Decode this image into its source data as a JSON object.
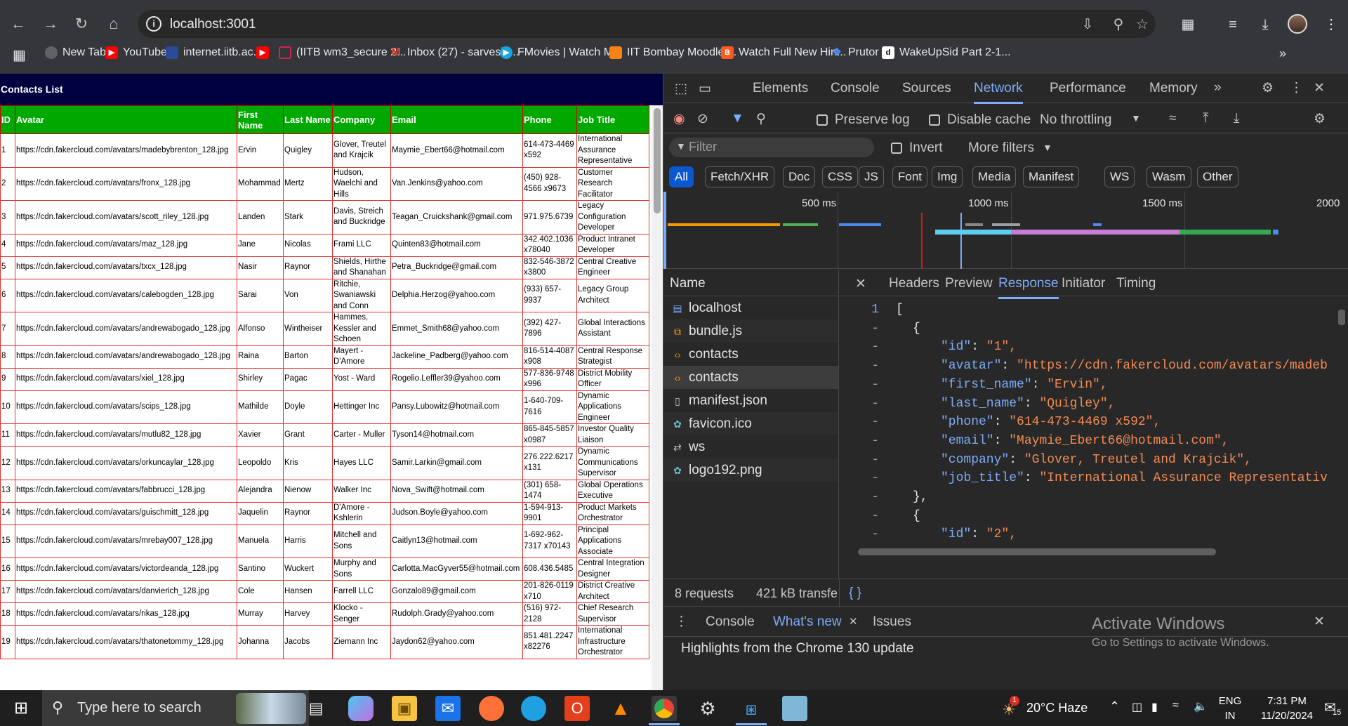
{
  "browser": {
    "url": "localhost:3001",
    "bookmarks": [
      {
        "label": "New Tab",
        "icon": "globe-icon",
        "color": "#5f6368"
      },
      {
        "label": "YouTube",
        "icon": "youtube-icon",
        "color": "#ff0000"
      },
      {
        "label": "internet.iitb.ac.in",
        "icon": "iitb-icon",
        "color": "#2a4a9a"
      },
      {
        "label": "",
        "icon": "youtube-icon",
        "color": "#ff0000"
      },
      {
        "label": "(IITB wm3_secure 2...",
        "icon": "document-icon",
        "color": "#d0254d"
      },
      {
        "label": "Inbox (27) - sarveshj...",
        "icon": "gmail-icon",
        "color": "#ea4335"
      },
      {
        "label": "FMovies | Watch M...",
        "icon": "play-icon",
        "color": "#1aa7e0"
      },
      {
        "label": "IIT Bombay Moodle:...",
        "icon": "moodle-icon",
        "color": "#f98012"
      },
      {
        "label": "Watch Full New Hin...",
        "icon": "blogger-icon",
        "color": "#ff5722"
      },
      {
        "label": "Prutor",
        "icon": "puzzle-icon",
        "color": "#4a8af4"
      },
      {
        "label": "WakeUpSid Part 2-1...",
        "icon": "letter-d-icon",
        "color": "#ffffff"
      }
    ]
  },
  "page": {
    "title": "Contacts List",
    "columns": [
      "ID",
      "Avatar",
      "First Name",
      "Last Name",
      "Company",
      "Email",
      "Phone",
      "Job Title"
    ],
    "rows": [
      [
        "1",
        "https://cdn.fakercloud.com/avatars/madebybrenton_128.jpg",
        "Ervin",
        "Quigley",
        "Glover, Treutel and Krajcik",
        "Maymie_Ebert66@hotmail.com",
        "614-473-4469 x592",
        "International Assurance Representative"
      ],
      [
        "2",
        "https://cdn.fakercloud.com/avatars/fronx_128.jpg",
        "Mohammad",
        "Mertz",
        "Hudson, Waelchi and Hills",
        "Van.Jenkins@yahoo.com",
        "(450) 928-4566 x9673",
        "Customer Research Facilitator"
      ],
      [
        "3",
        "https://cdn.fakercloud.com/avatars/scott_riley_128.jpg",
        "Landen",
        "Stark",
        "Davis, Streich and Buckridge",
        "Teagan_Cruickshank@gmail.com",
        "971.975.6739",
        "Legacy Configuration Developer"
      ],
      [
        "4",
        "https://cdn.fakercloud.com/avatars/maz_128.jpg",
        "Jane",
        "Nicolas",
        "Frami LLC",
        "Quinten83@hotmail.com",
        "342.402.1036 x78040",
        "Product Intranet Developer"
      ],
      [
        "5",
        "https://cdn.fakercloud.com/avatars/txcx_128.jpg",
        "Nasir",
        "Raynor",
        "Shields, Hirthe and Shanahan",
        "Petra_Buckridge@gmail.com",
        "832-546-3872 x3800",
        "Central Creative Engineer"
      ],
      [
        "6",
        "https://cdn.fakercloud.com/avatars/calebogden_128.jpg",
        "Sarai",
        "Von",
        "Ritchie, Swaniawski and Conn",
        "Delphia.Herzog@yahoo.com",
        "(933) 657-9937",
        "Legacy Group Architect"
      ],
      [
        "7",
        "https://cdn.fakercloud.com/avatars/andrewabogado_128.jpg",
        "Alfonso",
        "Wintheiser",
        "Hammes, Kessler and Schoen",
        "Emmet_Smith68@yahoo.com",
        "(392) 427-7896",
        "Global Interactions Assistant"
      ],
      [
        "8",
        "https://cdn.fakercloud.com/avatars/andrewabogado_128.jpg",
        "Raina",
        "Barton",
        "Mayert - D'Amore",
        "Jackeline_Padberg@yahoo.com",
        "816-514-4087 x908",
        "Central Response Strategist"
      ],
      [
        "9",
        "https://cdn.fakercloud.com/avatars/xiel_128.jpg",
        "Shirley",
        "Pagac",
        "Yost - Ward",
        "Rogelio.Leffler39@yahoo.com",
        "577-836-9748 x996",
        "District Mobility Officer"
      ],
      [
        "10",
        "https://cdn.fakercloud.com/avatars/scips_128.jpg",
        "Mathilde",
        "Doyle",
        "Hettinger Inc",
        "Pansy.Lubowitz@hotmail.com",
        "1-640-709-7616",
        "Dynamic Applications Engineer"
      ],
      [
        "11",
        "https://cdn.fakercloud.com/avatars/mutlu82_128.jpg",
        "Xavier",
        "Grant",
        "Carter - Muller",
        "Tyson14@hotmail.com",
        "865-845-5857 x0987",
        "Investor Quality Liaison"
      ],
      [
        "12",
        "https://cdn.fakercloud.com/avatars/orkuncaylar_128.jpg",
        "Leopoldo",
        "Kris",
        "Hayes LLC",
        "Samir.Larkin@gmail.com",
        "276.222.6217 x131",
        "Dynamic Communications Supervisor"
      ],
      [
        "13",
        "https://cdn.fakercloud.com/avatars/fabbrucci_128.jpg",
        "Alejandra",
        "Nienow",
        "Walker Inc",
        "Nova_Swift@hotmail.com",
        "(301) 658-1474",
        "Global Operations Executive"
      ],
      [
        "14",
        "https://cdn.fakercloud.com/avatars/guischmitt_128.jpg",
        "Jaquelin",
        "Raynor",
        "D'Amore - Kshlerin",
        "Judson.Boyle@yahoo.com",
        "1-594-913-9901",
        "Product Markets Orchestrator"
      ],
      [
        "15",
        "https://cdn.fakercloud.com/avatars/mrebay007_128.jpg",
        "Manuela",
        "Harris",
        "Mitchell and Sons",
        "Caitlyn13@hotmail.com",
        "1-692-962-7317 x70143",
        "Principal Applications Associate"
      ],
      [
        "16",
        "https://cdn.fakercloud.com/avatars/victordeanda_128.jpg",
        "Santino",
        "Wuckert",
        "Murphy and Sons",
        "Carlotta.MacGyver55@hotmail.com",
        "608.436.5485",
        "Central Integration Designer"
      ],
      [
        "17",
        "https://cdn.fakercloud.com/avatars/danvierich_128.jpg",
        "Cole",
        "Hansen",
        "Farrell LLC",
        "Gonzalo89@gmail.com",
        "201-826-0119 x710",
        "District Creative Architect"
      ],
      [
        "18",
        "https://cdn.fakercloud.com/avatars/rikas_128.jpg",
        "Murray",
        "Harvey",
        "Klocko - Senger",
        "Rudolph.Grady@yahoo.com",
        "(516) 972-2128",
        "Chief Research Supervisor"
      ],
      [
        "19",
        "https://cdn.fakercloud.com/avatars/thatonetommy_128.jpg",
        "Johanna",
        "Jacobs",
        "Ziemann Inc",
        "Jaydon62@yahoo.com",
        "851.481.2247 x82276",
        "International Infrastructure Orchestrator"
      ]
    ]
  },
  "devtools": {
    "tabs": [
      "Elements",
      "Console",
      "Sources",
      "Network",
      "Performance",
      "Memory"
    ],
    "active_tab": "Network",
    "toolbar": {
      "preserve_log": "Preserve log",
      "disable_cache": "Disable cache",
      "throttling": "No throttling"
    },
    "filter": {
      "placeholder": "Filter",
      "invert": "Invert",
      "more_filters": "More filters"
    },
    "types": [
      "All",
      "Fetch/XHR",
      "Doc",
      "CSS",
      "JS",
      "Font",
      "Img",
      "Media",
      "Manifest",
      "WS",
      "Wasm",
      "Other"
    ],
    "timeline_labels": [
      "500 ms",
      "1000 ms",
      "1500 ms",
      "2000"
    ],
    "name_header": "Name",
    "requests": [
      {
        "name": "localhost",
        "icon": "document-icon",
        "color": "#7cacf8"
      },
      {
        "name": "bundle.js",
        "icon": "script-icon",
        "color": "#f29900"
      },
      {
        "name": "contacts",
        "icon": "fetch-icon",
        "color": "#f29900"
      },
      {
        "name": "contacts",
        "icon": "fetch-icon",
        "color": "#f29900"
      },
      {
        "name": "manifest.json",
        "icon": "file-icon",
        "color": "#c7c7c7"
      },
      {
        "name": "favicon.ico",
        "icon": "image-icon",
        "color": "#6bbcc6"
      },
      {
        "name": "ws",
        "icon": "websocket-icon",
        "color": "#c7c7c7"
      },
      {
        "name": "logo192.png",
        "icon": "image-icon",
        "color": "#6bbcc6"
      }
    ],
    "response_tabs": [
      "Headers",
      "Preview",
      "Response",
      "Initiator",
      "Timing"
    ],
    "active_response_tab": "Response",
    "response_lines": [
      {
        "num": "1",
        "text": "["
      },
      {
        "num": "-",
        "text": "  {"
      },
      {
        "num": "-",
        "key": "\"id\"",
        "val": "\"1\","
      },
      {
        "num": "-",
        "key": "\"avatar\"",
        "val": "\"https://cdn.fakercloud.com/avatars/madeb"
      },
      {
        "num": "-",
        "key": "\"first_name\"",
        "val": "\"Ervin\","
      },
      {
        "num": "-",
        "key": "\"last_name\"",
        "val": "\"Quigley\","
      },
      {
        "num": "-",
        "key": "\"phone\"",
        "val": "\"614-473-4469 x592\","
      },
      {
        "num": "-",
        "key": "\"email\"",
        "val": "\"Maymie_Ebert66@hotmail.com\","
      },
      {
        "num": "-",
        "key": "\"company\"",
        "val": "\"Glover, Treutel and Krajcik\","
      },
      {
        "num": "-",
        "key": "\"job_title\"",
        "val": "\"International Assurance Representativ"
      },
      {
        "num": "-",
        "text": "  },"
      },
      {
        "num": "-",
        "text": "  {"
      },
      {
        "num": "-",
        "key": "\"id\"",
        "val": "\"2\","
      }
    ],
    "status": {
      "requests": "8 requests",
      "transferred": "421 kB transfe"
    },
    "drawer": {
      "tabs": [
        "Console",
        "What's new",
        "Issues"
      ],
      "active": "What's new",
      "highlight": "Highlights from the Chrome 130 update"
    },
    "watermark": {
      "title": "Activate Windows",
      "subtitle": "Go to Settings to activate Windows."
    }
  },
  "taskbar": {
    "search_placeholder": "Type here to search",
    "weather": "20°C  Haze",
    "notification_count": "1",
    "language": "ENG",
    "region": "IN",
    "time": "7:31 PM",
    "date": "11/20/2024",
    "action_center_count": "15"
  }
}
